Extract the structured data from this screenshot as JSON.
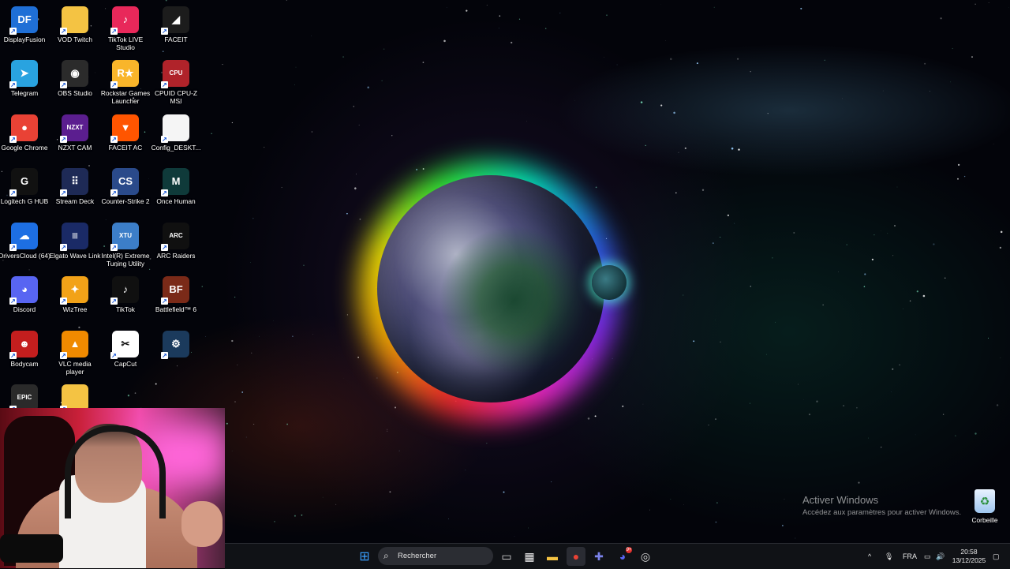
{
  "desktop_icons": [
    {
      "label": "DisplayFusion",
      "icon": "displayfusion-icon",
      "color": "#1f6fd6",
      "glyph": "DF"
    },
    {
      "label": "VOD Twitch",
      "icon": "folder-icon",
      "color": "#f4c343",
      "glyph": ""
    },
    {
      "label": "TikTok LIVE Studio",
      "icon": "tiktok-live-studio-icon",
      "color": "#e8285a",
      "glyph": "♪"
    },
    {
      "label": "FACEIT",
      "icon": "faceit-icon",
      "color": "#1c1c1c",
      "glyph": "◢"
    },
    {
      "label": "Telegram",
      "icon": "telegram-icon",
      "color": "#29a3e0",
      "glyph": "➤"
    },
    {
      "label": "OBS Studio",
      "icon": "obs-icon",
      "color": "#2b2b2b",
      "glyph": "◉"
    },
    {
      "label": "Rockstar Games Launcher",
      "icon": "rockstar-icon",
      "color": "#f9b52a",
      "glyph": "R★"
    },
    {
      "label": "CPUID CPU-Z MSI",
      "icon": "cpuz-icon",
      "color": "#b0232a",
      "glyph": "CPU"
    },
    {
      "label": "Google Chrome",
      "icon": "chrome-icon",
      "color": "#e94235",
      "glyph": "●"
    },
    {
      "label": "NZXT CAM",
      "icon": "nzxt-icon",
      "color": "#5b1e8f",
      "glyph": "NZXT"
    },
    {
      "label": "FACEIT AC",
      "icon": "faceit-ac-icon",
      "color": "#ff5500",
      "glyph": "▼"
    },
    {
      "label": "Config_DESKT...",
      "icon": "file-icon",
      "color": "#f5f5f5",
      "glyph": ""
    },
    {
      "label": "Logitech G HUB",
      "icon": "logitech-icon",
      "color": "#111111",
      "glyph": "G"
    },
    {
      "label": "Stream Deck",
      "icon": "stream-deck-icon",
      "color": "#1e2a56",
      "glyph": "⠿"
    },
    {
      "label": "Counter-Strike 2",
      "icon": "cs2-icon",
      "color": "#2a4a8a",
      "glyph": "CS"
    },
    {
      "label": "Once Human",
      "icon": "once-human-icon",
      "color": "#0f3a3a",
      "glyph": "M"
    },
    {
      "label": "DriversCloud (64)",
      "icon": "driverscloud-icon",
      "color": "#1d6fe3",
      "glyph": "☁"
    },
    {
      "label": "Elgato Wave Link",
      "icon": "wave-link-icon",
      "color": "#1a2a66",
      "glyph": "|||"
    },
    {
      "label": "Intel(R) Extreme Tuning Utility",
      "icon": "intel-xtu-icon",
      "color": "#3c7ec8",
      "glyph": "XTU"
    },
    {
      "label": "ARC Raiders",
      "icon": "arc-raiders-icon",
      "color": "#101010",
      "glyph": "ARC"
    },
    {
      "label": "Discord",
      "icon": "discord-icon",
      "color": "#5865f2",
      "glyph": "◕"
    },
    {
      "label": "WizTree",
      "icon": "wiztree-icon",
      "color": "#f2a218",
      "glyph": "✦"
    },
    {
      "label": "TikTok",
      "icon": "tiktok-icon",
      "color": "#101010",
      "glyph": "♪"
    },
    {
      "label": "Battlefield™ 6",
      "icon": "battlefield-icon",
      "color": "#7a2a18",
      "glyph": "BF"
    },
    {
      "label": "Bodycam",
      "icon": "bodycam-icon",
      "color": "#c41e1e",
      "glyph": "☻"
    },
    {
      "label": "VLC media player",
      "icon": "vlc-icon",
      "color": "#f08a00",
      "glyph": "▲"
    },
    {
      "label": "CapCut",
      "icon": "capcut-icon",
      "color": "#ffffff",
      "glyph": "✂"
    },
    {
      "label": "",
      "icon": "steam-icon",
      "color": "#1b3a5c",
      "glyph": "⚙"
    },
    {
      "label": "",
      "icon": "epic-games-icon",
      "color": "#2a2a2a",
      "glyph": "EPIC"
    },
    {
      "label": "",
      "icon": "folder-icon",
      "color": "#f4c343",
      "glyph": ""
    }
  ],
  "watermark": {
    "title": "Activer Windows",
    "subtitle": "Accédez aux paramètres pour activer Windows."
  },
  "recycle_bin": {
    "label": "Corbeille"
  },
  "taskbar": {
    "search_placeholder": "Rechercher",
    "apps": [
      {
        "name": "start-button",
        "glyph": "⊞",
        "color": "#3aa0ff"
      },
      {
        "name": "task-view-button",
        "glyph": "▭",
        "color": "#d8d8d8"
      },
      {
        "name": "store-button",
        "glyph": "▦",
        "color": "#f2f2f2"
      },
      {
        "name": "file-explorer-button",
        "glyph": "▬",
        "color": "#f4c343"
      },
      {
        "name": "chrome-taskbar-button",
        "glyph": "●",
        "color": "#e94235"
      },
      {
        "name": "teams-taskbar-button",
        "glyph": "✚",
        "color": "#7b83eb"
      },
      {
        "name": "discord-taskbar-button",
        "glyph": "◕",
        "color": "#5865f2"
      },
      {
        "name": "app-taskbar-button",
        "glyph": "◎",
        "color": "#d8d8d8"
      }
    ],
    "discord_badge": "9+",
    "tray": {
      "chevron": "^",
      "mic": "🎙",
      "language": "FRA",
      "network": "▭",
      "volume": "🔊",
      "notification": "▢"
    },
    "time": "20:58",
    "date": "13/12/2025"
  }
}
